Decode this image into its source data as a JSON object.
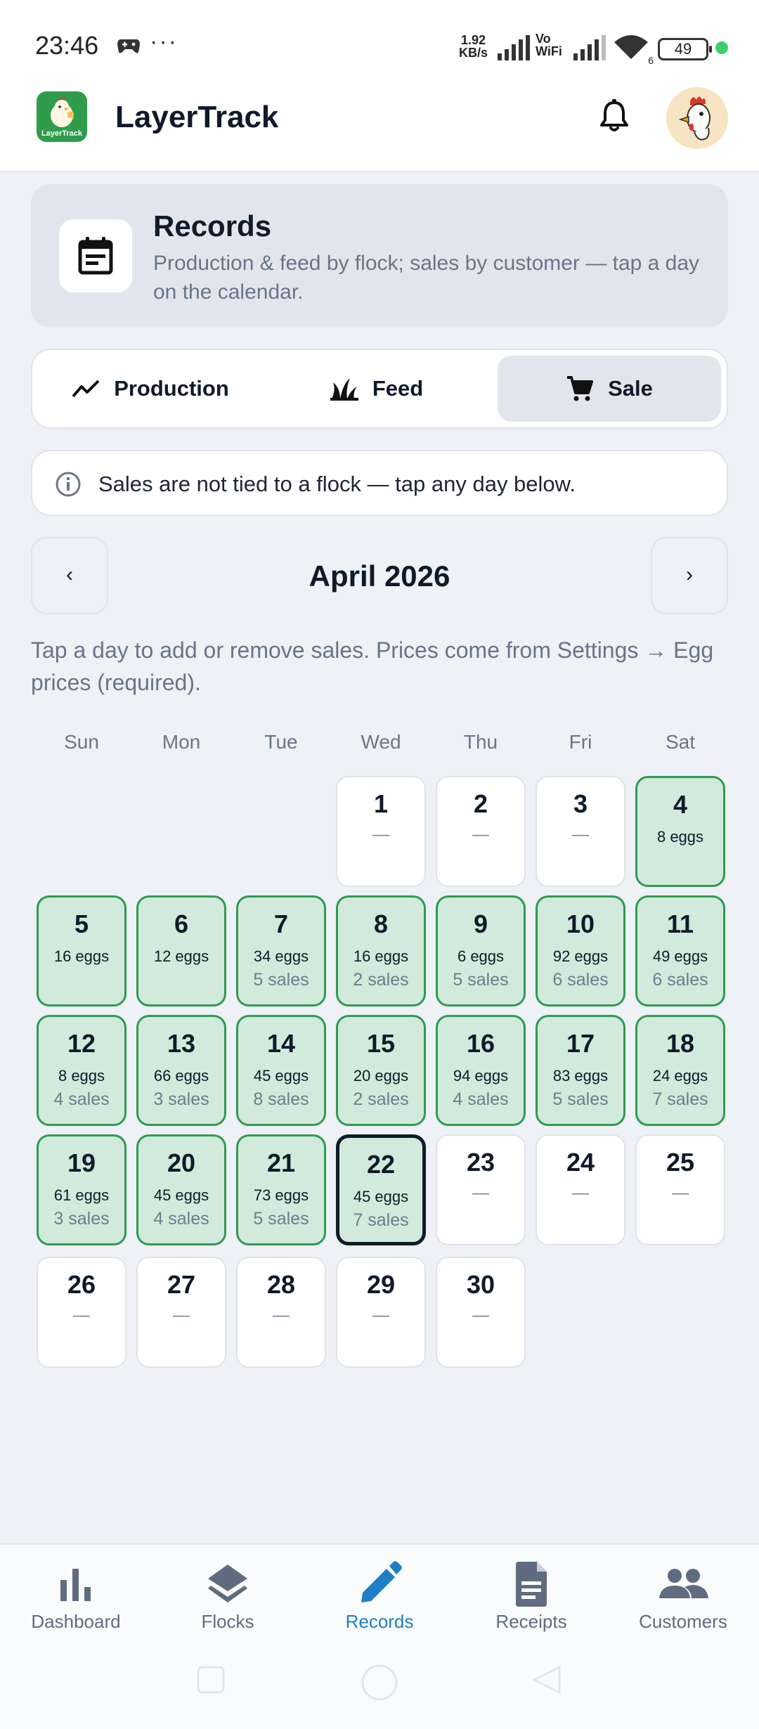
{
  "status_bar": {
    "time": "23:46",
    "more": "···",
    "net_speed_value": "1.92",
    "net_speed_unit": "KB/s",
    "vowifi_top": "Vo",
    "vowifi_bottom": "WiFi",
    "wifi_sub": "6",
    "battery": "49"
  },
  "app_bar": {
    "title": "LayerTrack",
    "logo_text": "LayerTrack",
    "icons": [
      "chicken-logo-icon",
      "bell-icon",
      "rooster-avatar"
    ]
  },
  "header": {
    "title": "Records",
    "subtitle": "Production & feed by flock; sales by customer — tap a day on the calendar.",
    "icon": "calendar-icon"
  },
  "tabs": [
    {
      "label": "Production",
      "icon": "trend-line-icon",
      "selected": false
    },
    {
      "label": "Feed",
      "icon": "grass-icon",
      "selected": false
    },
    {
      "label": "Sale",
      "icon": "cart-icon",
      "selected": true
    }
  ],
  "info": {
    "text": "Sales are not tied to a flock — tap any day below.",
    "icon": "info-icon"
  },
  "calendar": {
    "month": "April 2026",
    "prev": "‹",
    "next": "›",
    "hint": "Tap a day to add or remove sales. Prices come from Settings → Egg prices (required).",
    "weekdays": [
      "Sun",
      "Mon",
      "Tue",
      "Wed",
      "Thu",
      "Fri",
      "Sat"
    ],
    "first_weekday_index": 3,
    "today": 22,
    "days": [
      {
        "day": "1",
        "eggs": "",
        "sales": "",
        "empty": "—"
      },
      {
        "day": "2",
        "eggs": "",
        "sales": "",
        "empty": "—"
      },
      {
        "day": "3",
        "eggs": "",
        "sales": "",
        "empty": "—"
      },
      {
        "day": "4",
        "eggs": "8 eggs",
        "sales": "",
        "empty": ""
      },
      {
        "day": "5",
        "eggs": "16 eggs",
        "sales": "",
        "empty": ""
      },
      {
        "day": "6",
        "eggs": "12 eggs",
        "sales": "",
        "empty": ""
      },
      {
        "day": "7",
        "eggs": "34 eggs",
        "sales": "5 sales",
        "empty": ""
      },
      {
        "day": "8",
        "eggs": "16 eggs",
        "sales": "2 sales",
        "empty": ""
      },
      {
        "day": "9",
        "eggs": "6 eggs",
        "sales": "5 sales",
        "empty": ""
      },
      {
        "day": "10",
        "eggs": "92 eggs",
        "sales": "6 sales",
        "empty": ""
      },
      {
        "day": "11",
        "eggs": "49 eggs",
        "sales": "6 sales",
        "empty": ""
      },
      {
        "day": "12",
        "eggs": "8 eggs",
        "sales": "4 sales",
        "empty": ""
      },
      {
        "day": "13",
        "eggs": "66 eggs",
        "sales": "3 sales",
        "empty": ""
      },
      {
        "day": "14",
        "eggs": "45 eggs",
        "sales": "8 sales",
        "empty": ""
      },
      {
        "day": "15",
        "eggs": "20 eggs",
        "sales": "2 sales",
        "empty": ""
      },
      {
        "day": "16",
        "eggs": "94 eggs",
        "sales": "4 sales",
        "empty": ""
      },
      {
        "day": "17",
        "eggs": "83 eggs",
        "sales": "5 sales",
        "empty": ""
      },
      {
        "day": "18",
        "eggs": "24 eggs",
        "sales": "7 sales",
        "empty": ""
      },
      {
        "day": "19",
        "eggs": "61 eggs",
        "sales": "3 sales",
        "empty": ""
      },
      {
        "day": "20",
        "eggs": "45 eggs",
        "sales": "4 sales",
        "empty": ""
      },
      {
        "day": "21",
        "eggs": "73 eggs",
        "sales": "5 sales",
        "empty": ""
      },
      {
        "day": "22",
        "eggs": "45 eggs",
        "sales": "7 sales",
        "empty": ""
      },
      {
        "day": "23",
        "eggs": "",
        "sales": "",
        "empty": "—"
      },
      {
        "day": "24",
        "eggs": "",
        "sales": "",
        "empty": "—"
      },
      {
        "day": "25",
        "eggs": "",
        "sales": "",
        "empty": "—"
      },
      {
        "day": "26",
        "eggs": "",
        "sales": "",
        "empty": "—"
      },
      {
        "day": "27",
        "eggs": "",
        "sales": "",
        "empty": "—"
      },
      {
        "day": "28",
        "eggs": "",
        "sales": "",
        "empty": "—"
      },
      {
        "day": "29",
        "eggs": "",
        "sales": "",
        "empty": "—"
      },
      {
        "day": "30",
        "eggs": "",
        "sales": "",
        "empty": "—"
      }
    ]
  },
  "bottom_nav": [
    {
      "label": "Dashboard",
      "icon": "bar-chart-icon",
      "active": false
    },
    {
      "label": "Flocks",
      "icon": "layers-icon",
      "active": false
    },
    {
      "label": "Records",
      "icon": "pencil-icon",
      "active": true
    },
    {
      "label": "Receipts",
      "icon": "document-icon",
      "active": false
    },
    {
      "label": "Customers",
      "icon": "people-icon",
      "active": false
    }
  ],
  "colors": {
    "brand_green": "#2e9c4a",
    "sale_fill": "#d1eadb",
    "sale_border": "#2f9b52",
    "active_nav": "#1e7fc6",
    "text_dark": "#0f1a2a",
    "muted": "#687589"
  }
}
